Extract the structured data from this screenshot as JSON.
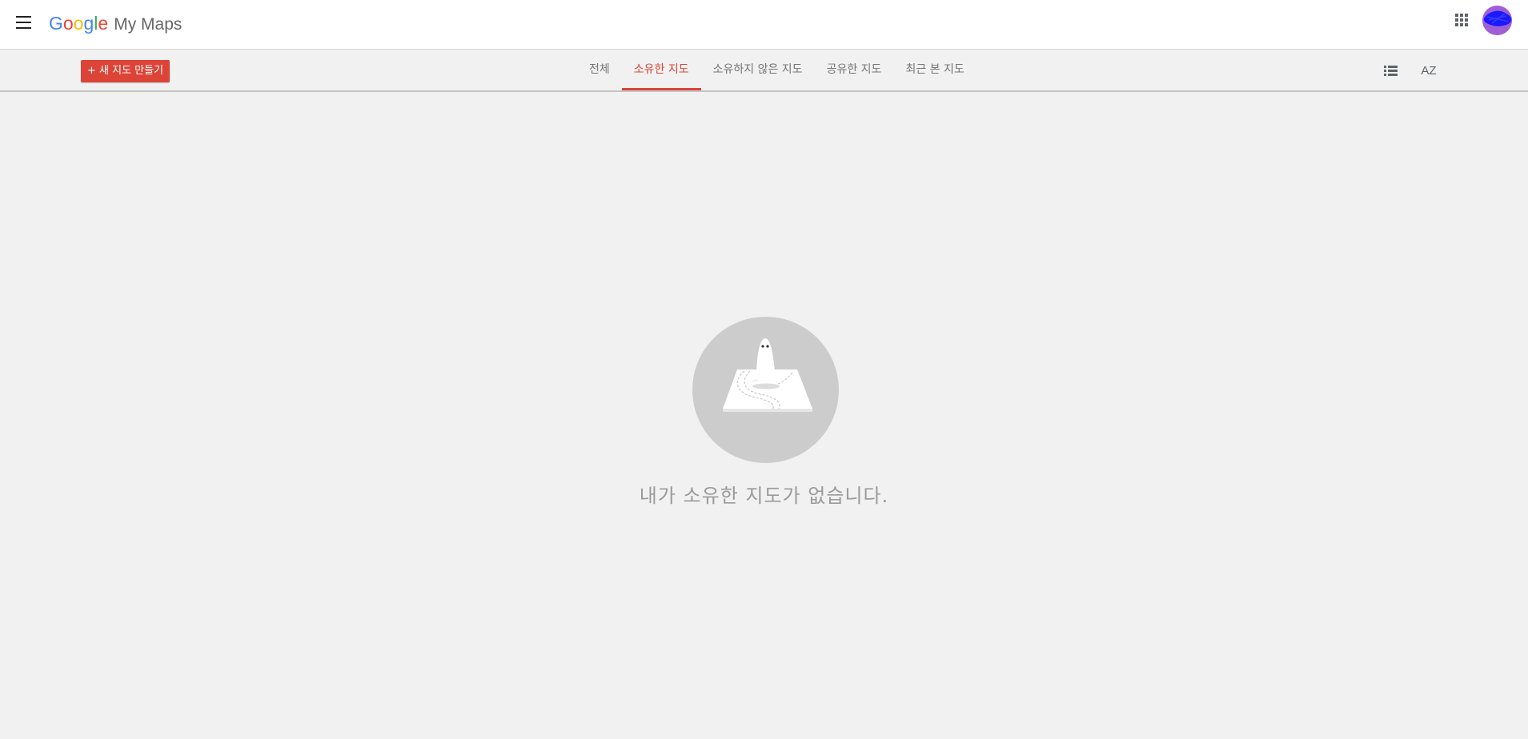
{
  "header": {
    "logo_letters": [
      "G",
      "o",
      "o",
      "g",
      "l",
      "e"
    ],
    "product_name": "My Maps",
    "menu_icon": "hamburger-menu-icon",
    "apps_icon": "apps-grid-icon",
    "avatar_icon": "account-avatar"
  },
  "toolbar": {
    "new_map_label": "+ 새 지도 만들기",
    "tabs": [
      {
        "label": "전체",
        "active": false
      },
      {
        "label": "소유한 지도",
        "active": true
      },
      {
        "label": "소유하지 않은 지도",
        "active": false
      },
      {
        "label": "공유한 지도",
        "active": false
      },
      {
        "label": "최근 본 지도",
        "active": false
      }
    ],
    "list_view_icon": "list-view-icon",
    "sort_label": "AZ"
  },
  "empty_state": {
    "illustration": "ghost-on-map-illustration",
    "message": "내가 소유한 지도가 없습니다."
  },
  "colors": {
    "accent": "#db4437",
    "background": "#f1f1f1",
    "header_bg": "#ffffff",
    "empty_circle": "#cccccc"
  }
}
